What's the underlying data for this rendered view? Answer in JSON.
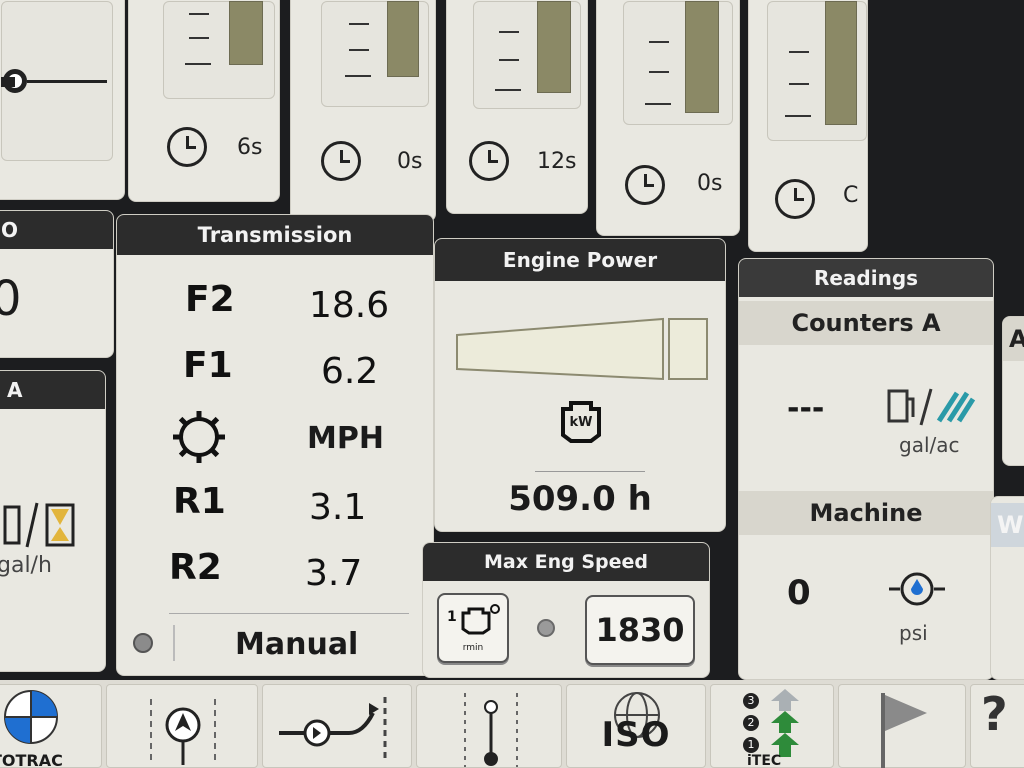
{
  "timers": [
    {
      "value": "6s"
    },
    {
      "value": "0s"
    },
    {
      "value": "12s"
    },
    {
      "value": "0s"
    },
    {
      "value": "C"
    }
  ],
  "left_edge": {
    "top_header_fragment": "O",
    "top_value_fragment": "0",
    "mid_header_fragment": "A",
    "unit": "gal/h"
  },
  "transmission": {
    "title": "Transmission",
    "rows": [
      {
        "label": "F2",
        "value": "18.6"
      },
      {
        "label": "F1",
        "value": "6.2"
      },
      {
        "label": "",
        "value": "MPH"
      },
      {
        "label": "R1",
        "value": "3.1"
      },
      {
        "label": "R2",
        "value": "3.7"
      }
    ],
    "mode": "Manual"
  },
  "engine_power": {
    "title": "Engine Power",
    "icon_text": "kW",
    "hours": "509.0 h"
  },
  "max_eng_speed": {
    "title": "Max Eng Speed",
    "value": "1830",
    "icon_text": "rmin"
  },
  "readings": {
    "title": "Readings",
    "counters_title": "Counters A",
    "counters_value": "---",
    "counters_unit": "gal/ac",
    "machine_title": "Machine",
    "machine_value": "0",
    "machine_unit": "psi"
  },
  "right_edge": {
    "frag1": "A",
    "frag2": "W"
  },
  "bottom_bar": {
    "autotrac_label": "TOTRAC",
    "iso_label": "ISO",
    "itec_label": "iTEC",
    "itec_numbers": [
      "3",
      "2",
      "1"
    ]
  },
  "colors": {
    "header_dark": "#2c2c2c",
    "panel_bg": "#e9e8e1",
    "bar_olive": "#8b8966",
    "itec_green": "#2e8b3a",
    "autotrac_blue": "#1f6fd1"
  }
}
